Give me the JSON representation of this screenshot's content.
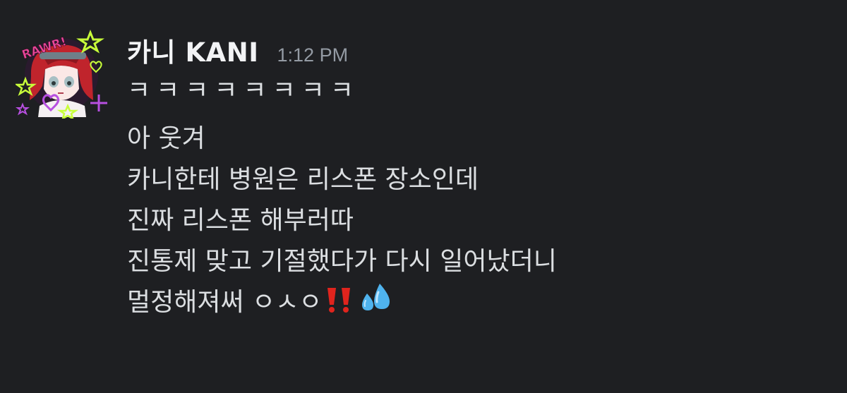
{
  "message": {
    "author": {
      "username": "카니 KANI",
      "avatar_icon": "anime-character-avatar-icon",
      "avatar_text": "RAWR!"
    },
    "timestamp": "1:12 PM",
    "lines": [
      "ㅋㅋㅋㅋㅋㅋㅋㅋ",
      "아 웃겨",
      "카니한테 병원은 리스폰 장소인데",
      "진짜 리스폰 해부러따",
      "진통제 맞고 기절했다가 다시 일어났더니",
      "멀정해져써 ㅇㅅㅇ"
    ],
    "emojis": [
      "double-exclamation-icon",
      "sweat-droplets-icon"
    ]
  },
  "colors": {
    "background": "#1e1f22",
    "username": "#f2f3f5",
    "timestamp": "#949ba4",
    "text": "#dbdee1",
    "exclamation": "#e0241d",
    "droplets": "#4fb3ee"
  }
}
